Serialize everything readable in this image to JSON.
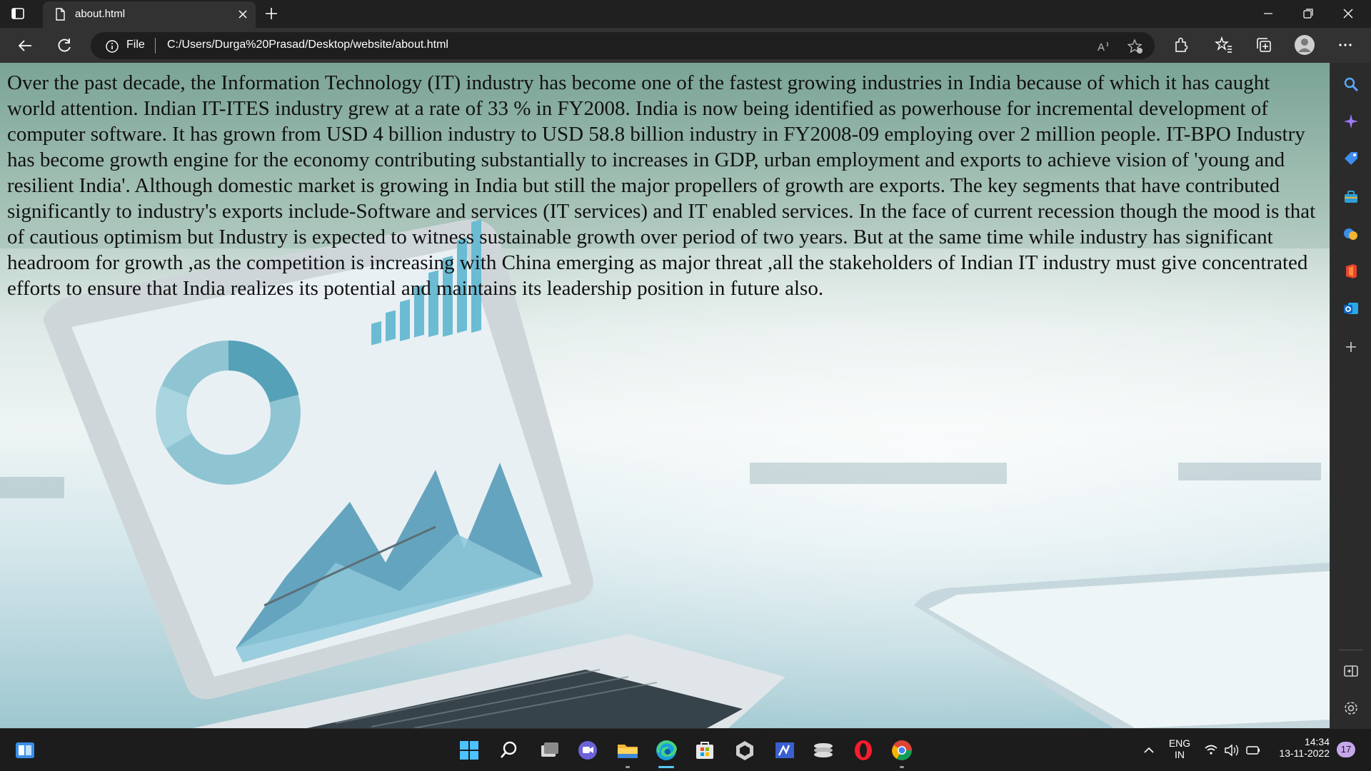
{
  "browser": {
    "tab": {
      "title": "about.html",
      "icon": "page-icon"
    },
    "address": {
      "scheme": "File",
      "url": "C:/Users/Durga%20Prasad/Desktop/website/about.html"
    },
    "toolbar_icons": [
      "read-aloud-icon",
      "add-favorite-icon",
      "extensions-icon",
      "favorites-icon",
      "collections-icon",
      "profile-icon",
      "more-icon"
    ]
  },
  "page": {
    "paragraph": "Over the past decade, the Information Technology (IT) industry has become one of the fastest growing industries in India because of which it has caught world attention. Indian IT-ITES industry grew at a rate of 33 % in FY2008. India is now being identified as powerhouse for incremental development of computer software. It has grown from USD 4 billion industry to USD 58.8 billion industry in FY2008-09 employing over 2 million people. IT-BPO Industry has become growth engine for the economy contributing substantially to increases in GDP, urban employment and exports to achieve vision of 'young and resilient India'. Although domestic market is growing in India but still the major propellers of growth are exports. The key segments that have contributed significantly to industry's exports include-Software and services (IT services) and IT enabled services. In the face of current recession though the mood is that of cautious optimism but Industry is expected to witness sustainable growth over period of two years. But at the same time while industry has significant headroom for growth ,as the competition is increasing with China emerging as major threat ,all the stakeholders of Indian IT industry must give concentrated efforts to ensure that India realizes its potential and maintains its leadership position in future also.",
    "background_image": "laptop-with-analytics-dashboard-photo"
  },
  "sidebar": {
    "icons": [
      "search-icon",
      "copilot-icon",
      "shopping-icon",
      "tools-icon",
      "games-icon",
      "office-icon",
      "outlook-icon",
      "add-icon",
      "split-screen-icon",
      "settings-icon"
    ]
  },
  "taskbar": {
    "apps": [
      "start-icon",
      "search-icon",
      "task-view-icon",
      "teams-chat-icon",
      "file-explorer-icon",
      "edge-icon",
      "store-icon",
      "unity-icon",
      "app-icon",
      "stack-icon",
      "opera-icon",
      "chrome-icon"
    ],
    "language": {
      "line1": "ENG",
      "line2": "IN"
    },
    "time": "14:34",
    "date": "13-11-2022",
    "notification_count": "17"
  },
  "colors": {
    "accent": "#5cc8ff",
    "badge": "#c6a7ec"
  }
}
